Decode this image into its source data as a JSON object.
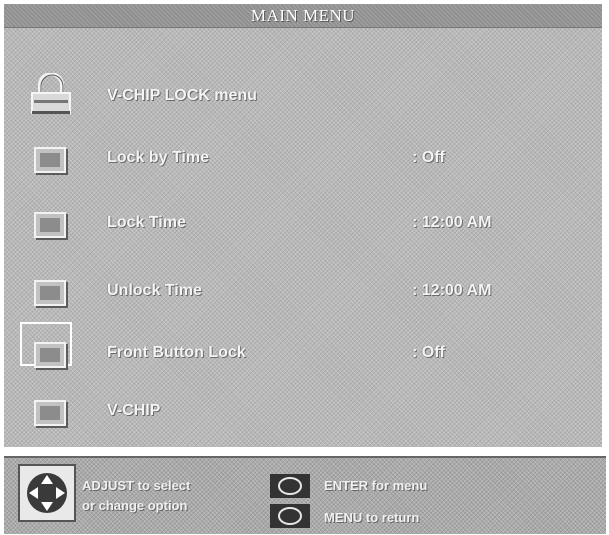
{
  "title": "MAIN MENU",
  "rows": [
    {
      "label": "V-CHIP LOCK menu",
      "value": "",
      "icon": "padlock-icon"
    },
    {
      "label": "Lock by Time",
      "value": ": Off",
      "icon": "checkbox-icon"
    },
    {
      "label": "Lock Time",
      "value": ": 12:00 AM",
      "icon": "checkbox-icon"
    },
    {
      "label": "Unlock Time",
      "value": ": 12:00 AM",
      "icon": "checkbox-icon"
    },
    {
      "label": "Front Button Lock",
      "value": ": Off",
      "icon": "checkbox-icon",
      "selected": true
    },
    {
      "label": "V-CHIP",
      "value": "",
      "icon": "checkbox-icon"
    }
  ],
  "footer": {
    "adjust_line1": "ADJUST to select",
    "adjust_line2": "or change option",
    "enter_hint": "ENTER for menu",
    "menu_hint": "MENU to return"
  },
  "colors": {
    "panel": "#b9b9b9",
    "title_bar": "#8f8f8f",
    "text": "#f4f4f4",
    "button_dark": "#333333"
  }
}
